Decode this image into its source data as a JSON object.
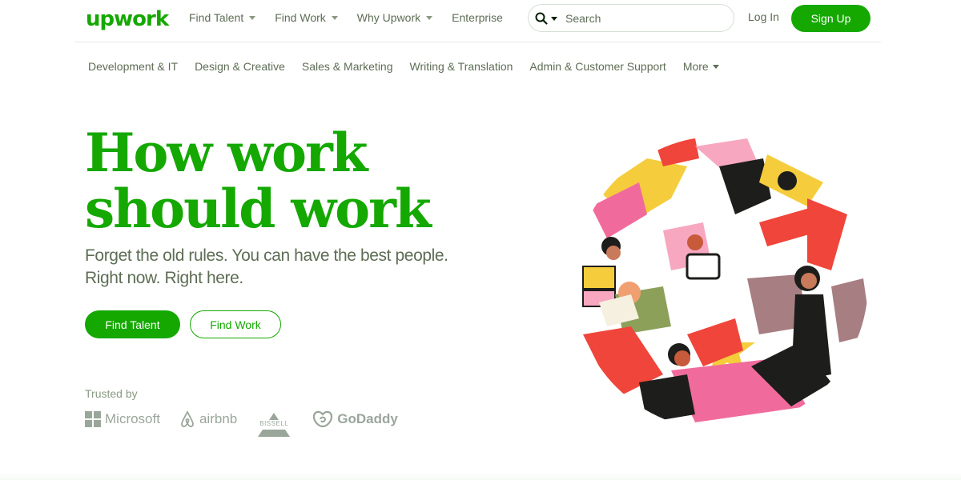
{
  "brand": {
    "logo": "upwork"
  },
  "header": {
    "nav": [
      {
        "label": "Find Talent",
        "has_caret": true
      },
      {
        "label": "Find Work",
        "has_caret": true
      },
      {
        "label": "Why Upwork",
        "has_caret": true
      },
      {
        "label": "Enterprise",
        "has_caret": false
      }
    ],
    "search": {
      "placeholder": "Search",
      "icon": "search-icon"
    },
    "login_label": "Log In",
    "signup_label": "Sign Up"
  },
  "categories": {
    "items": [
      "Development & IT",
      "Design & Creative",
      "Sales & Marketing",
      "Writing & Translation",
      "Admin & Customer Support"
    ],
    "more_label": "More"
  },
  "hero": {
    "headline_line1": "How work",
    "headline_line2": "should work",
    "subtitle_line1": "Forget the old rules. You can have the best people.",
    "subtitle_line2": "Right now. Right here.",
    "primary_cta": "Find Talent",
    "secondary_cta": "Find Work"
  },
  "trusted": {
    "label": "Trusted by",
    "logos": [
      "Microsoft",
      "airbnb",
      "BISSELL",
      "GoDaddy"
    ]
  },
  "colors": {
    "brand_green": "#14a800",
    "text_muted": "#5e6d55",
    "logo_gray": "#9aa69a"
  }
}
